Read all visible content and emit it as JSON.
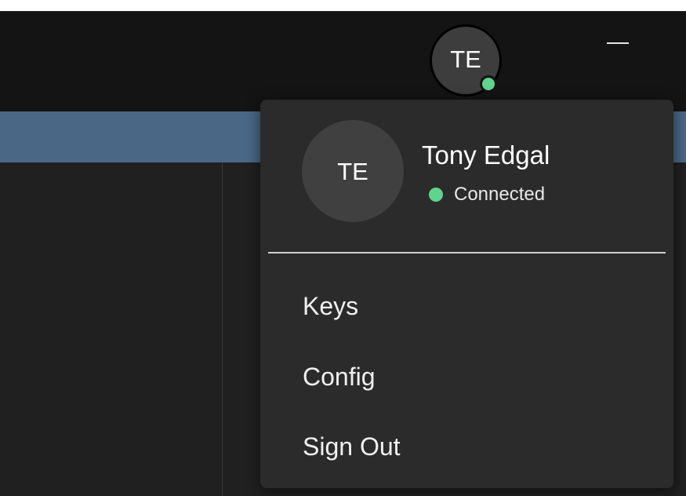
{
  "colors": {
    "accent_band": "#4a6786",
    "status_connected": "#5fd48e",
    "menu_background": "#2b2b2b",
    "titlebar_background": "#141414"
  },
  "titlebar": {
    "avatar_initials": "TE",
    "minimize_icon": "minimize-icon"
  },
  "user_menu": {
    "avatar_initials": "TE",
    "user_name": "Tony Edgal",
    "status": "Connected",
    "items": [
      {
        "label": "Keys"
      },
      {
        "label": "Config"
      },
      {
        "label": "Sign Out"
      }
    ]
  }
}
